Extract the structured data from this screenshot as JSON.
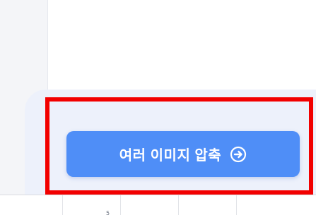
{
  "action": {
    "compress_label": "여러 이미지 압축",
    "icon": "arrow-right-circle-icon"
  },
  "colors": {
    "button_bg": "#4f8ef7",
    "panel_bg": "#edf1fb",
    "highlight": "#f20000"
  },
  "bottom": {
    "mark": "5"
  }
}
